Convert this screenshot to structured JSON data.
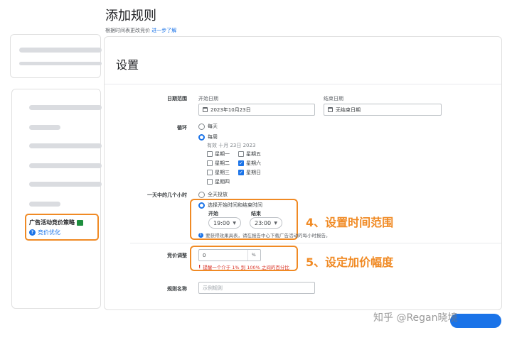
{
  "page": {
    "title": "添加规则",
    "subtitle": "根据时间表更改竞价",
    "learn_more": "进一步了解"
  },
  "left_panel": {
    "strategy_title": "广告活动竞价策略",
    "strategy_link": "竞价优化"
  },
  "settings": {
    "section_title": "设置",
    "date_range": {
      "label": "日期范围",
      "start_caption": "开始日期",
      "start_value": "2023年10月23日",
      "end_caption": "结束日期",
      "end_value": "无结束日期"
    },
    "recurrence": {
      "label": "循环",
      "daily": "每天",
      "weekly": "每周",
      "effective_note": "有效 十月 23日 2023",
      "days": [
        {
          "name": "星期一",
          "checked": false
        },
        {
          "name": "星期二",
          "checked": false
        },
        {
          "name": "星期三",
          "checked": false
        },
        {
          "name": "星期四",
          "checked": false
        },
        {
          "name": "星期五",
          "checked": false
        },
        {
          "name": "星期六",
          "checked": true
        },
        {
          "name": "星期日",
          "checked": true
        }
      ]
    },
    "hours": {
      "label": "一天中的几个小时",
      "all_day": "全天投放",
      "choose_time": "选择开始时间和结束时间",
      "start_caption": "开始",
      "start_value": "19:00",
      "end_caption": "结束",
      "end_value": "23:00",
      "info": "要获得效果具表，请在报告中心下载广告活动的每小时报告。"
    },
    "bid_adjust": {
      "label": "竞价调整",
      "value": "0",
      "unit": "%",
      "error": "提醒一个介于 1% 到 100% 之间的百分比"
    },
    "rule_name": {
      "label": "规则名称",
      "placeholder": "示例规则"
    }
  },
  "annotations": {
    "step4": "4、设置时间范围",
    "step5": "5、设定加价幅度"
  },
  "watermark": "知乎 @Regan晓境"
}
